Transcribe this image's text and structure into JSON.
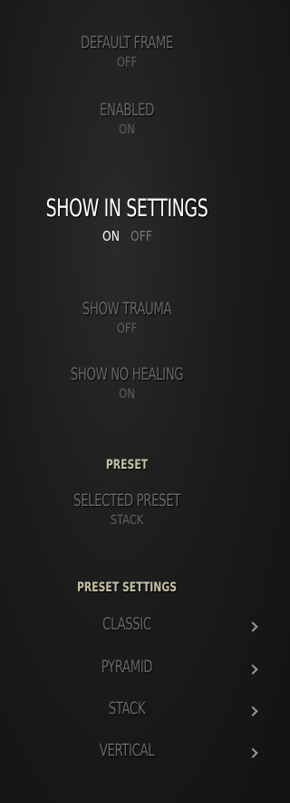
{
  "settings": {
    "default_frame": {
      "title": "DEFAULT FRAME",
      "value": "OFF"
    },
    "enabled": {
      "title": "ENABLED",
      "value": "ON"
    },
    "show_in_settings": {
      "title": "SHOW IN SETTINGS",
      "on": "ON",
      "off": "OFF",
      "selected": "ON"
    },
    "show_trauma": {
      "title": "SHOW TRAUMA",
      "value": "OFF"
    },
    "show_no_healing": {
      "title": "SHOW NO HEALING",
      "value": "ON"
    }
  },
  "preset_section": {
    "header": "PRESET"
  },
  "selected_preset": {
    "title": "SELECTED PRESET",
    "value": "STACK"
  },
  "preset_settings_section": {
    "header": "PRESET SETTINGS"
  },
  "preset_items": [
    {
      "label": "CLASSIC",
      "icon": "chevron-right-icon"
    },
    {
      "label": "PYRAMID",
      "icon": "chevron-right-icon"
    },
    {
      "label": "STACK",
      "icon": "chevron-right-icon"
    },
    {
      "label": "VERTICAL",
      "icon": "chevron-right-icon"
    }
  ]
}
